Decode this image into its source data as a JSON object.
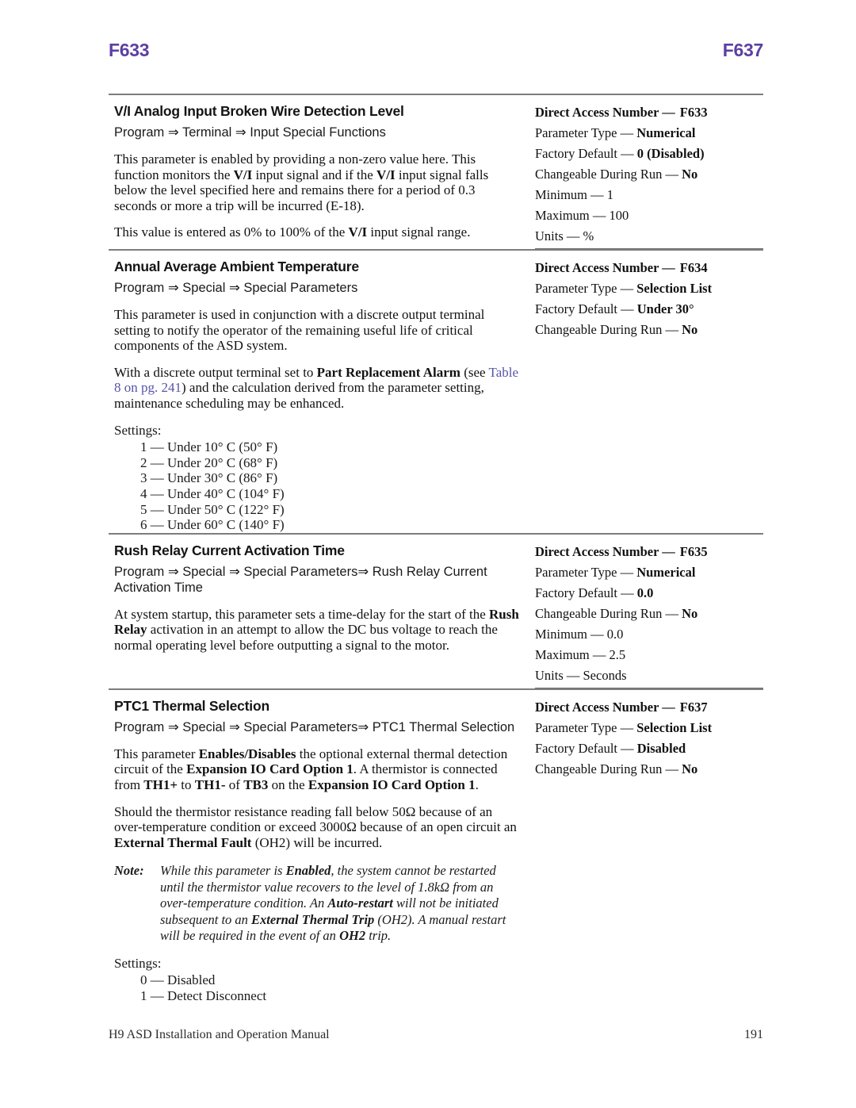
{
  "header": {
    "left": "F633",
    "right": "F637",
    "color": "#5c3fa3"
  },
  "sections": [
    {
      "title": "V/I Analog Input Broken Wire Detection Level",
      "path": "Program ⇒ Terminal ⇒ Input Special Functions",
      "para1_a": "This parameter is enabled by providing a non-zero value here. This function monitors the ",
      "para1_b": "V/I",
      "para1_c": " input signal and if the ",
      "para1_d": "V/I",
      "para1_e": " input signal falls below the level specified here and remains there for a period of 0.3 seconds or more a trip will be incurred (E-18).",
      "para2_a": "This value is entered as 0% to 100% of the ",
      "para2_b": "V/I",
      "para2_c": " input signal range.",
      "spec": {
        "dan_label": "Direct Access Number —",
        "dan_value": "F633",
        "rows": [
          {
            "key": "Parameter Type — ",
            "value": "Numerical"
          },
          {
            "key": "Factory Default — ",
            "value": "0 (Disabled)"
          },
          {
            "key": "Changeable During Run — ",
            "value": "No"
          },
          {
            "key": "Minimum — 1",
            "value": ""
          },
          {
            "key": "Maximum — 100",
            "value": ""
          },
          {
            "key": "Units — %",
            "value": ""
          }
        ]
      }
    },
    {
      "title": "Annual Average Ambient Temperature",
      "path": "Program ⇒ Special ⇒ Special Parameters",
      "para1": "This parameter is used in conjunction with a discrete output terminal setting to notify the operator of the remaining useful life of critical components of the ASD system.",
      "para2_a": "With a discrete output terminal set to ",
      "para2_b": "Part Replacement Alarm",
      "para2_c": " (see ",
      "para2_link": "Table 8 on pg. 241",
      "para2_d": ") and the calculation derived from the parameter setting, maintenance scheduling may be enhanced.",
      "settings_label": "Settings:",
      "settings": [
        "1 — Under 10° C (50° F)",
        "2 — Under 20° C (68° F)",
        "3 — Under 30° C (86° F)",
        "4 — Under 40° C (104° F)",
        "5 — Under 50° C (122° F)",
        "6 — Under 60° C (140° F)"
      ],
      "spec": {
        "dan_label": "Direct Access Number —",
        "dan_value": "F634",
        "rows": [
          {
            "key": "Parameter Type — ",
            "value": "Selection List"
          },
          {
            "key": "Factory Default — ",
            "value": "Under 30°"
          },
          {
            "key": "Changeable During Run — ",
            "value": "No"
          }
        ]
      }
    },
    {
      "title": "Rush Relay Current Activation Time",
      "path": "Program ⇒ Special ⇒ Special Parameters⇒ Rush Relay Current Activation Time",
      "para1_a": "At system startup, this parameter sets a time-delay for the start of the ",
      "para1_b": "Rush Relay",
      "para1_c": " activation in an attempt to allow the DC bus voltage to reach the normal operating level before outputting a signal to the motor.",
      "spec": {
        "dan_label": "Direct Access Number —",
        "dan_value": "F635",
        "rows": [
          {
            "key": "Parameter Type — ",
            "value": "Numerical"
          },
          {
            "key": "Factory Default — ",
            "value": "0.0"
          },
          {
            "key": "Changeable During Run — ",
            "value": "No"
          },
          {
            "key": "Minimum — 0.0",
            "value": ""
          },
          {
            "key": "Maximum — 2.5",
            "value": ""
          },
          {
            "key": "Units — Seconds",
            "value": ""
          }
        ]
      }
    },
    {
      "title": "PTC1 Thermal Selection",
      "path": "Program ⇒ Special ⇒ Special Parameters⇒ PTC1 Thermal Selection",
      "para1_a": "This parameter ",
      "para1_b": "Enables/Disables",
      "para1_c": " the optional external thermal detection circuit of the ",
      "para1_d": "Expansion IO Card Option 1",
      "para1_e": ". A thermistor is connected from ",
      "para1_f": "TH1+",
      "para1_g": " to ",
      "para1_h": "TH1-",
      "para1_i": " of ",
      "para1_j": "TB3",
      "para1_k": " on the ",
      "para1_l": "Expansion IO Card Option 1",
      "para1_m": ".",
      "para2_a": "Should the thermistor resistance reading fall below 50Ω because of an over-temperature condition or exceed 3000Ω because of an open circuit an ",
      "para2_b": "External Thermal Fault",
      "para2_c": " (OH2) will be incurred.",
      "note_label": "Note:",
      "note_a": "While this parameter is ",
      "note_b": "Enabled",
      "note_c": ", the system cannot be restarted until the thermistor value recovers to the level of 1.8kΩ from an over-temperature condition. An ",
      "note_d": "Auto-restart",
      "note_e": " will not be initiated subsequent to an ",
      "note_f": "External Thermal Trip",
      "note_g": " (OH2). A manual restart will be required in the event of an ",
      "note_h": "OH2",
      "note_i": " trip.",
      "settings_label": "Settings:",
      "settings": [
        "0 — Disabled",
        "1 — Detect Disconnect"
      ],
      "spec": {
        "dan_label": "Direct Access Number —",
        "dan_value": "F637",
        "rows": [
          {
            "key": "Parameter Type — ",
            "value": "Selection List"
          },
          {
            "key": "Factory Default — ",
            "value": "Disabled"
          },
          {
            "key": "Changeable During Run — ",
            "value": "No"
          }
        ]
      }
    }
  ],
  "footer": {
    "manual": "H9 ASD Installation and Operation Manual",
    "page": "191"
  }
}
